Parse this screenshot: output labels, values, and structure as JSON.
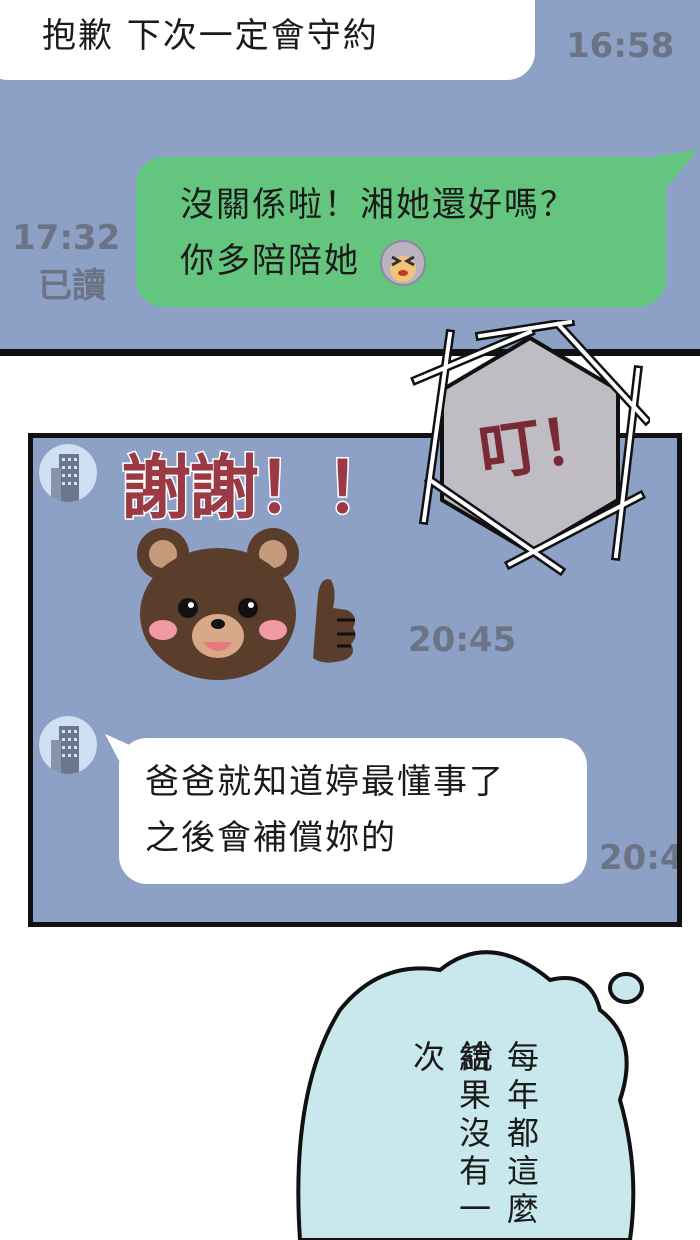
{
  "top_panel": {
    "msg1": {
      "text": "抱歉 下次一定會守約",
      "time": "16:58"
    },
    "msg2": {
      "line1": "沒關係啦！湘她還好嗎？",
      "line2": "你多陪陪她",
      "time": "17:32",
      "read": "已讀",
      "emoji": "wince-face-icon"
    }
  },
  "sfx": {
    "text": "叮！"
  },
  "mid_panel": {
    "sticker": {
      "text": "謝謝！！",
      "icon": "bear-thumbs-up-icon",
      "time": "20:45"
    },
    "msg": {
      "line1": "爸爸就知道婷最懂事了",
      "line2": "之後會補償妳的",
      "time": "20:4"
    }
  },
  "thought": {
    "col1": "每年都這麼說",
    "col2": "結果沒有一次"
  },
  "colors": {
    "chat_bg": "#8da0c6",
    "green_bubble": "#64c67e",
    "thought_bg": "#c8e8ed"
  }
}
